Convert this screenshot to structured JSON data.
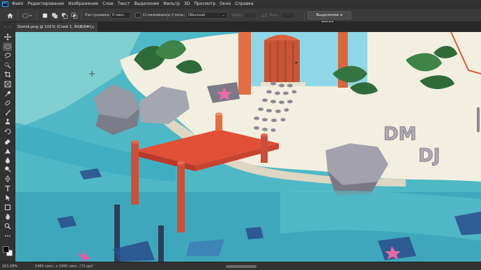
{
  "app": {
    "logo_text": "Ps"
  },
  "menu": {
    "items": [
      "Файл",
      "Редактирование",
      "Изображение",
      "Слои",
      "Текст",
      "Выделение",
      "Фильтр",
      "3D",
      "Просмотр",
      "Окно",
      "Справка"
    ]
  },
  "options": {
    "feather_label": "Растушевка:",
    "feather_value": "0 пикс.",
    "antialias_label": "Сглаживание",
    "style_label": "Стиль:",
    "style_value": "Обычный",
    "width_label": "Шир.:",
    "height_label": "Выс.:",
    "select_mask_label": "Выделение и маска..."
  },
  "document": {
    "tab_title": "Domik.png @ 101% (Слой 1, RGB/8#)",
    "tab_close": "×"
  },
  "status": {
    "zoom": "101,09%",
    "doc_info": "2460 пикс. x 2460 пикс. (72 ppi)"
  },
  "tools": [
    {
      "name": "move-tool-icon"
    },
    {
      "name": "marquee-tool-icon"
    },
    {
      "name": "lasso-tool-icon"
    },
    {
      "name": "quick-select-tool-icon"
    },
    {
      "name": "crop-tool-icon"
    },
    {
      "name": "frame-tool-icon"
    },
    {
      "name": "eyedropper-tool-icon"
    },
    {
      "name": "healing-brush-tool-icon"
    },
    {
      "name": "brush-tool-icon"
    },
    {
      "name": "clone-stamp-tool-icon"
    },
    {
      "name": "history-brush-tool-icon"
    },
    {
      "name": "eraser-tool-icon"
    },
    {
      "name": "gradient-tool-icon"
    },
    {
      "name": "blur-tool-icon"
    },
    {
      "name": "dodge-tool-icon"
    },
    {
      "name": "pen-tool-icon"
    },
    {
      "name": "type-tool-icon"
    },
    {
      "name": "path-select-tool-icon"
    },
    {
      "name": "shape-tool-icon"
    },
    {
      "name": "hand-tool-icon"
    },
    {
      "name": "zoom-tool-icon"
    },
    {
      "name": "more-tools-icon"
    }
  ],
  "colors": {
    "foreground": "#000000",
    "background": "#ffffff",
    "accent": "#31a8ff"
  },
  "canvas_image": {
    "scene_letters": "DM DJ"
  }
}
